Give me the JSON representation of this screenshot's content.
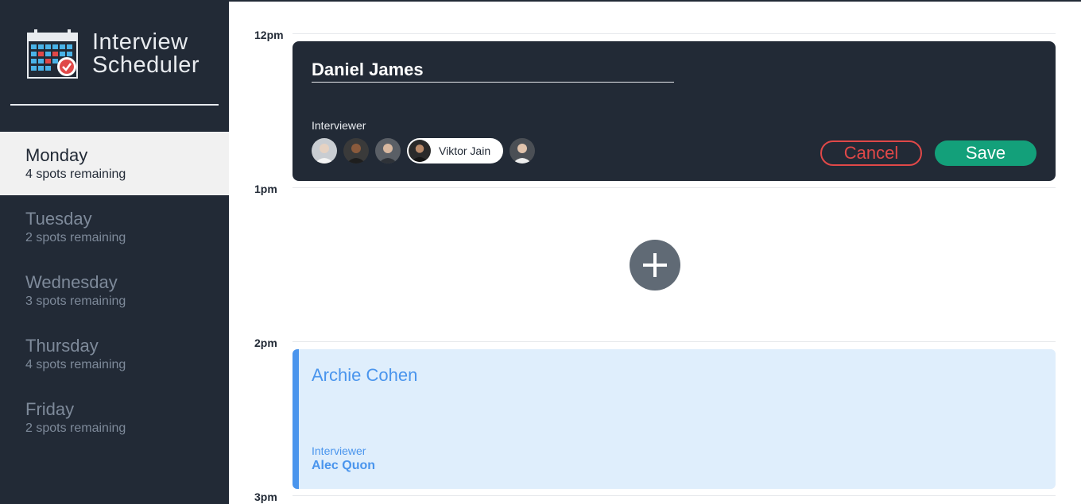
{
  "brand": {
    "line1": "Interview",
    "line2": "Scheduler",
    "icon": "calendar-check-icon"
  },
  "days": [
    {
      "name": "Monday",
      "spots": "4 spots remaining",
      "selected": true
    },
    {
      "name": "Tuesday",
      "spots": "2 spots remaining",
      "selected": false
    },
    {
      "name": "Wednesday",
      "spots": "3 spots remaining",
      "selected": false
    },
    {
      "name": "Thursday",
      "spots": "4 spots remaining",
      "selected": false
    },
    {
      "name": "Friday",
      "spots": "2 spots remaining",
      "selected": false
    }
  ],
  "schedule": {
    "times": [
      "12pm",
      "1pm",
      "2pm",
      "3pm"
    ],
    "edit_form": {
      "student_name": "Daniel James",
      "interviewer_label": "Interviewer",
      "selected_interviewer": "Viktor Jain",
      "cancel_label": "Cancel",
      "save_label": "Save"
    },
    "add_icon": "plus-icon",
    "appointment": {
      "student": "Archie Cohen",
      "interviewer_label": "Interviewer",
      "interviewer": "Alec Quon"
    }
  },
  "colors": {
    "sidebar": "#222a36",
    "selected_day_bg": "#f1f1f1",
    "cancel": "#e04848",
    "save": "#13a07a",
    "appointment_accent": "#4a95ed",
    "appointment_bg": "#dfeefc"
  }
}
